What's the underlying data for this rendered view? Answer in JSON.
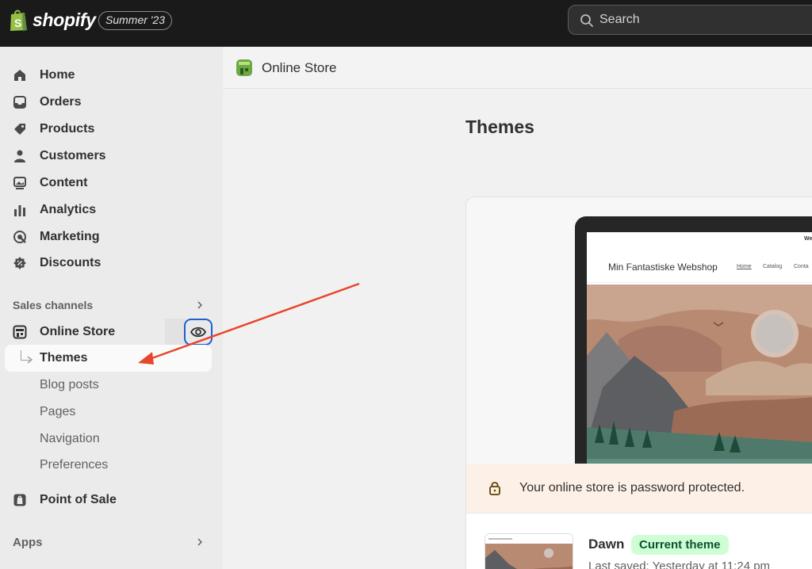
{
  "app": {
    "brand": "shopify",
    "edition_badge": "Summer '23",
    "search_placeholder": "Search"
  },
  "sidebar": {
    "main_items": [
      {
        "label": "Home",
        "icon": "home-icon"
      },
      {
        "label": "Orders",
        "icon": "inbox-icon"
      },
      {
        "label": "Products",
        "icon": "tag-icon"
      },
      {
        "label": "Customers",
        "icon": "person-icon"
      },
      {
        "label": "Content",
        "icon": "image-icon"
      },
      {
        "label": "Analytics",
        "icon": "bar-chart-icon"
      },
      {
        "label": "Marketing",
        "icon": "target-icon"
      },
      {
        "label": "Discounts",
        "icon": "discount-icon"
      }
    ],
    "sales_channels_heading": "Sales channels",
    "online_store": "Online Store",
    "online_store_sub": [
      "Themes",
      "Blog posts",
      "Pages",
      "Navigation",
      "Preferences"
    ],
    "point_of_sale": "Point of Sale",
    "apps_heading": "Apps"
  },
  "main": {
    "header_title": "Online Store",
    "page_title": "Themes",
    "preview": {
      "shop_name": "Min Fantastiske Webshop",
      "links": [
        "Home",
        "Catalog",
        "Conta"
      ],
      "top_note": "We"
    },
    "password_notice": "Your online store is password protected.",
    "theme": {
      "name": "Dawn",
      "badge": "Current theme",
      "last_saved": "Last saved: Yesterday at 11:24 pm"
    }
  },
  "colors": {
    "topbar": "#1a1a1a",
    "sidebar": "#ebebeb",
    "accent_focus": "#1f5fd1",
    "annotation_arrow": "#e8452c",
    "badge_green": "#cdfed4"
  }
}
